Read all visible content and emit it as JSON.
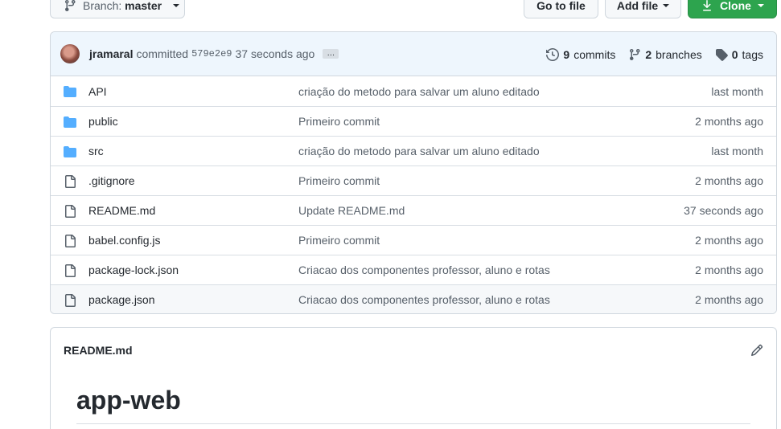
{
  "toolbar": {
    "branch_prefix": "Branch:",
    "branch_name": "master",
    "goto_file": "Go to file",
    "add_file": "Add file",
    "clone": "Clone"
  },
  "commit": {
    "author": "jramaral",
    "verb": "committed",
    "sha": "579e2e9",
    "time": "37 seconds ago",
    "more": "…",
    "commits_count": "9",
    "commits_label": "commits",
    "branches_count": "2",
    "branches_label": "branches",
    "tags_count": "0",
    "tags_label": "tags"
  },
  "files": [
    {
      "type": "folder",
      "name": "API",
      "message": "criação do metodo para salvar um aluno editado",
      "age": "last month"
    },
    {
      "type": "folder",
      "name": "public",
      "message": "Primeiro commit",
      "age": "2 months ago"
    },
    {
      "type": "folder",
      "name": "src",
      "message": "criação do metodo para salvar um aluno editado",
      "age": "last month"
    },
    {
      "type": "file",
      "name": ".gitignore",
      "message": "Primeiro commit",
      "age": "2 months ago"
    },
    {
      "type": "file",
      "name": "README.md",
      "message": "Update README.md",
      "age": "37 seconds ago"
    },
    {
      "type": "file",
      "name": "babel.config.js",
      "message": "Primeiro commit",
      "age": "2 months ago"
    },
    {
      "type": "file",
      "name": "package-lock.json",
      "message": "Criacao dos componentes professor, aluno e rotas",
      "age": "2 months ago"
    },
    {
      "type": "file",
      "name": "package.json",
      "message": "Criacao dos componentes professor, aluno e rotas",
      "age": "2 months ago"
    }
  ],
  "readme": {
    "title": "README.md",
    "heading": "app-web"
  },
  "colors": {
    "accent_green": "#2da44e",
    "folder_blue": "#54aeff",
    "commit_bar_bg": "#eef6fd"
  }
}
